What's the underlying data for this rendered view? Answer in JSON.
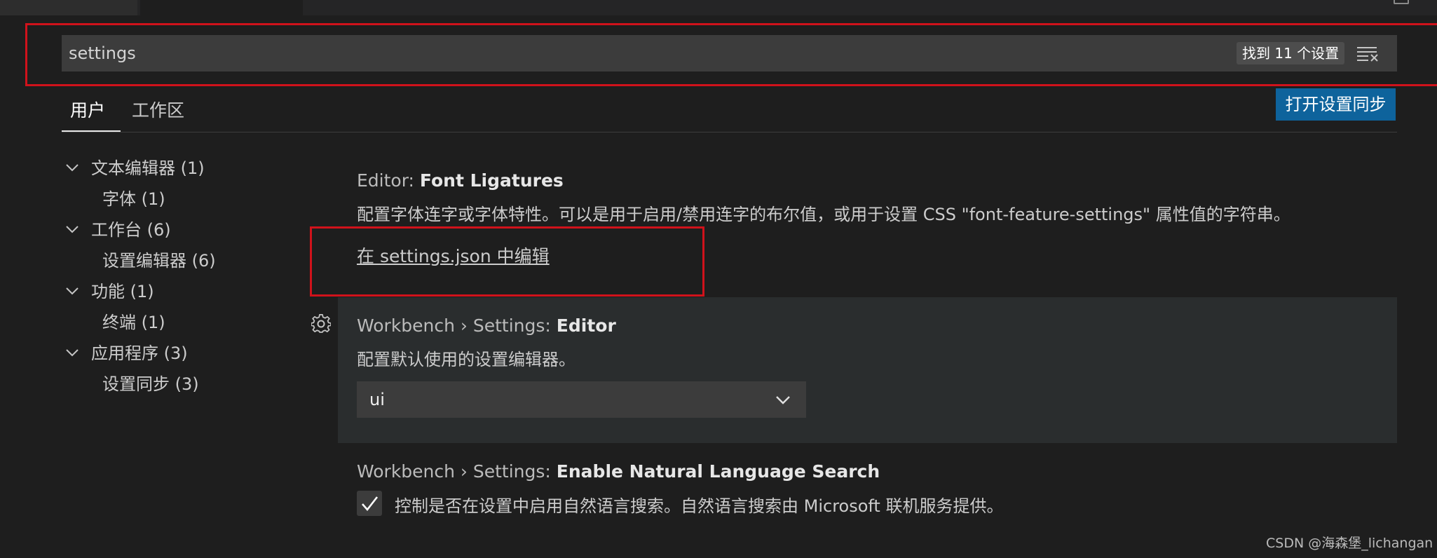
{
  "search": {
    "value": "settings",
    "result_count": "找到 11 个设置",
    "clear_icon": "clear-filter-icon"
  },
  "tabs": [
    {
      "label": "用户",
      "active": true
    },
    {
      "label": "工作区",
      "active": false
    }
  ],
  "sync_button": {
    "label": "打开设置同步",
    "color": "#0e639c"
  },
  "tree": [
    {
      "label": "文本编辑器 (1)",
      "level": 0
    },
    {
      "label": "字体 (1)",
      "level": 1
    },
    {
      "label": "工作台 (6)",
      "level": 0
    },
    {
      "label": "设置编辑器 (6)",
      "level": 1
    },
    {
      "label": "功能 (1)",
      "level": 0
    },
    {
      "label": "终端 (1)",
      "level": 1
    },
    {
      "label": "应用程序 (3)",
      "level": 0
    },
    {
      "label": "设置同步 (3)",
      "level": 1
    }
  ],
  "settings": [
    {
      "category": "Editor: ",
      "name": "Font Ligatures",
      "description": "配置字体连字或字体特性。可以是用于启用/禁用连字的布尔值，或用于设置 CSS \"font-feature-settings\" 属性值的字符串。",
      "link": "在 settings.json 中编辑"
    },
    {
      "category": "Workbench › Settings: ",
      "name": "Editor",
      "description": "配置默认使用的设置编辑器。",
      "select_value": "ui"
    },
    {
      "category": "Workbench › Settings: ",
      "name": "Enable Natural Language Search",
      "description": "控制是否在设置中启用自然语言搜索。自然语言搜索由 Microsoft 联机服务提供。",
      "checked": true
    }
  ],
  "watermark": "CSDN @海森堡_lichangan",
  "colors": {
    "highlight": "#d0121b",
    "background": "#1e1e1e"
  }
}
